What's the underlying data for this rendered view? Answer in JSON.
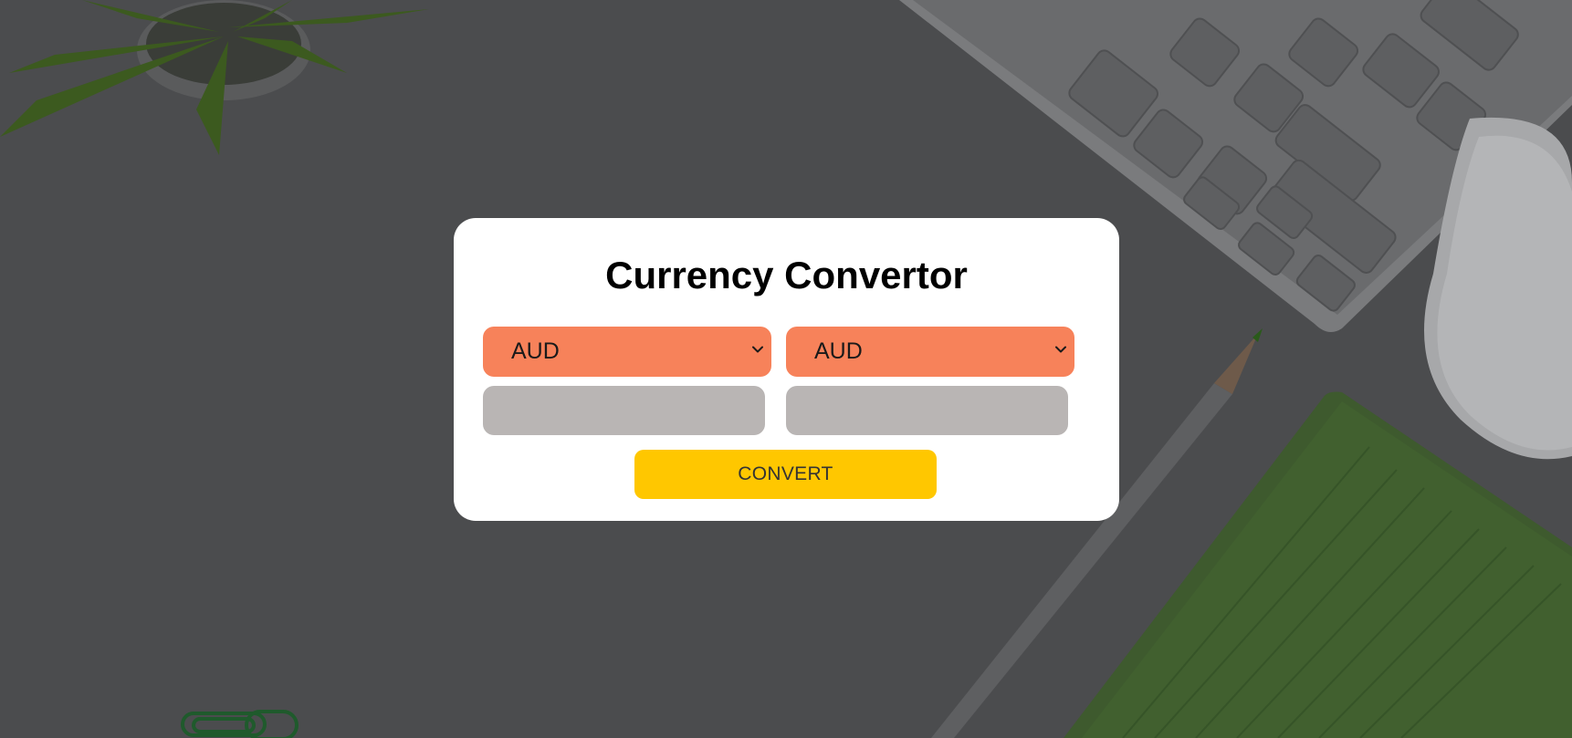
{
  "app": {
    "title": "Currency Convertor"
  },
  "converter": {
    "from_currency": "AUD",
    "to_currency": "AUD",
    "from_amount": "",
    "to_amount": "",
    "convert_label": "CONVERT"
  },
  "icons": {
    "select_arrow": "chevron-down-icon"
  },
  "colors": {
    "card_background": "#ffffff",
    "select_background": "#f7825a",
    "input_background": "#b9b5b4",
    "button_background": "#ffc700",
    "page_overlay": "#4b4c4e"
  }
}
